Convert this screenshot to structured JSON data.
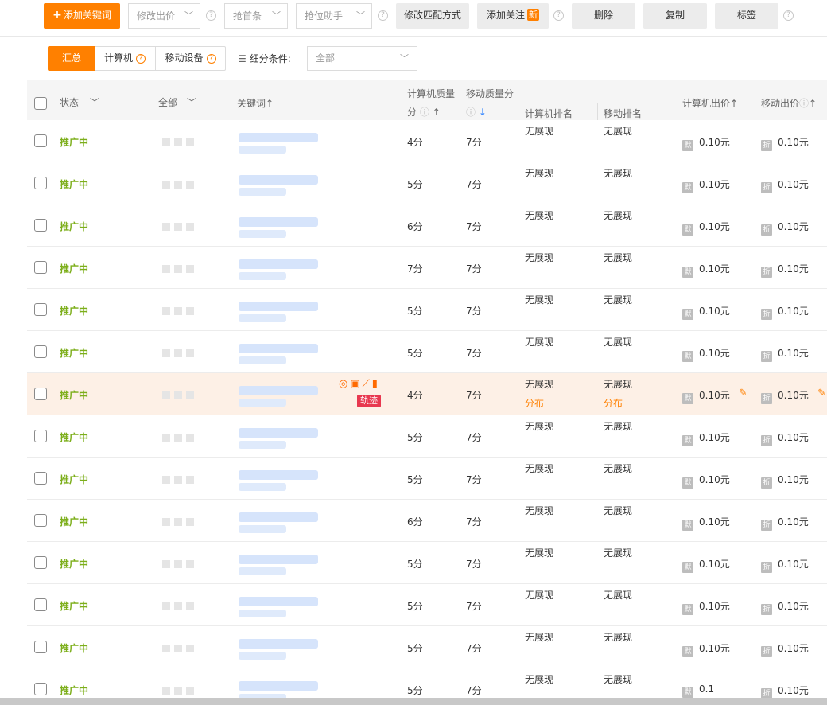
{
  "toolbar": {
    "add_keyword": "添加关键词",
    "modify_bid": "修改出价",
    "grab_top": "抢首条",
    "grab_assistant": "抢位助手",
    "modify_match": "修改匹配方式",
    "add_follow": "添加关注",
    "new_badge": "新",
    "delete": "删除",
    "copy": "复制",
    "tag": "标签"
  },
  "device_tabs": {
    "summary": "汇总",
    "computer": "计算机",
    "mobile": "移动设备"
  },
  "sub_filter": {
    "label": "细分条件:",
    "value": "全部"
  },
  "columns": {
    "status": "状态",
    "all": "全部",
    "keyword": "关键词↑",
    "pc_quality_line1": "计算机质量",
    "pc_quality_line2": "分",
    "mobile_quality": "移动质量分",
    "pc_rank": "计算机排名",
    "mobile_rank": "移动排名",
    "pc_bid": "计算机出价↑",
    "mobile_bid": "移动出价"
  },
  "highlight_row": {
    "distribution": "分布",
    "trace_label": "轨迹"
  },
  "rows": [
    {
      "status": "推广中",
      "pc_qs": "4分",
      "m_qs": "7分",
      "pc_rank": "无展现",
      "m_rank": "无展现",
      "pc_bid": "0.10元",
      "m_bid": "0.10元"
    },
    {
      "status": "推广中",
      "pc_qs": "5分",
      "m_qs": "7分",
      "pc_rank": "无展现",
      "m_rank": "无展现",
      "pc_bid": "0.10元",
      "m_bid": "0.10元"
    },
    {
      "status": "推广中",
      "pc_qs": "6分",
      "m_qs": "7分",
      "pc_rank": "无展现",
      "m_rank": "无展现",
      "pc_bid": "0.10元",
      "m_bid": "0.10元"
    },
    {
      "status": "推广中",
      "pc_qs": "7分",
      "m_qs": "7分",
      "pc_rank": "无展现",
      "m_rank": "无展现",
      "pc_bid": "0.10元",
      "m_bid": "0.10元"
    },
    {
      "status": "推广中",
      "pc_qs": "5分",
      "m_qs": "7分",
      "pc_rank": "无展现",
      "m_rank": "无展现",
      "pc_bid": "0.10元",
      "m_bid": "0.10元"
    },
    {
      "status": "推广中",
      "pc_qs": "5分",
      "m_qs": "7分",
      "pc_rank": "无展现",
      "m_rank": "无展现",
      "pc_bid": "0.10元",
      "m_bid": "0.10元"
    },
    {
      "status": "推广中",
      "pc_qs": "4分",
      "m_qs": "7分",
      "pc_rank": "无展现",
      "m_rank": "无展现",
      "pc_bid": "0.10元",
      "m_bid": "0.10元",
      "highlight": true
    },
    {
      "status": "推广中",
      "pc_qs": "5分",
      "m_qs": "7分",
      "pc_rank": "无展现",
      "m_rank": "无展现",
      "pc_bid": "0.10元",
      "m_bid": "0.10元"
    },
    {
      "status": "推广中",
      "pc_qs": "5分",
      "m_qs": "7分",
      "pc_rank": "无展现",
      "m_rank": "无展现",
      "pc_bid": "0.10元",
      "m_bid": "0.10元"
    },
    {
      "status": "推广中",
      "pc_qs": "6分",
      "m_qs": "7分",
      "pc_rank": "无展现",
      "m_rank": "无展现",
      "pc_bid": "0.10元",
      "m_bid": "0.10元"
    },
    {
      "status": "推广中",
      "pc_qs": "5分",
      "m_qs": "7分",
      "pc_rank": "无展现",
      "m_rank": "无展现",
      "pc_bid": "0.10元",
      "m_bid": "0.10元"
    },
    {
      "status": "推广中",
      "pc_qs": "5分",
      "m_qs": "7分",
      "pc_rank": "无展现",
      "m_rank": "无展现",
      "pc_bid": "0.10元",
      "m_bid": "0.10元"
    },
    {
      "status": "推广中",
      "pc_qs": "5分",
      "m_qs": "7分",
      "pc_rank": "无展现",
      "m_rank": "无展现",
      "pc_bid": "0.10元",
      "m_bid": "0.10元"
    },
    {
      "status": "推广中",
      "pc_qs": "5分",
      "m_qs": "7分",
      "pc_rank": "无展现",
      "m_rank": "无展现",
      "pc_bid": "0.1",
      "m_bid": "0.10元"
    }
  ]
}
